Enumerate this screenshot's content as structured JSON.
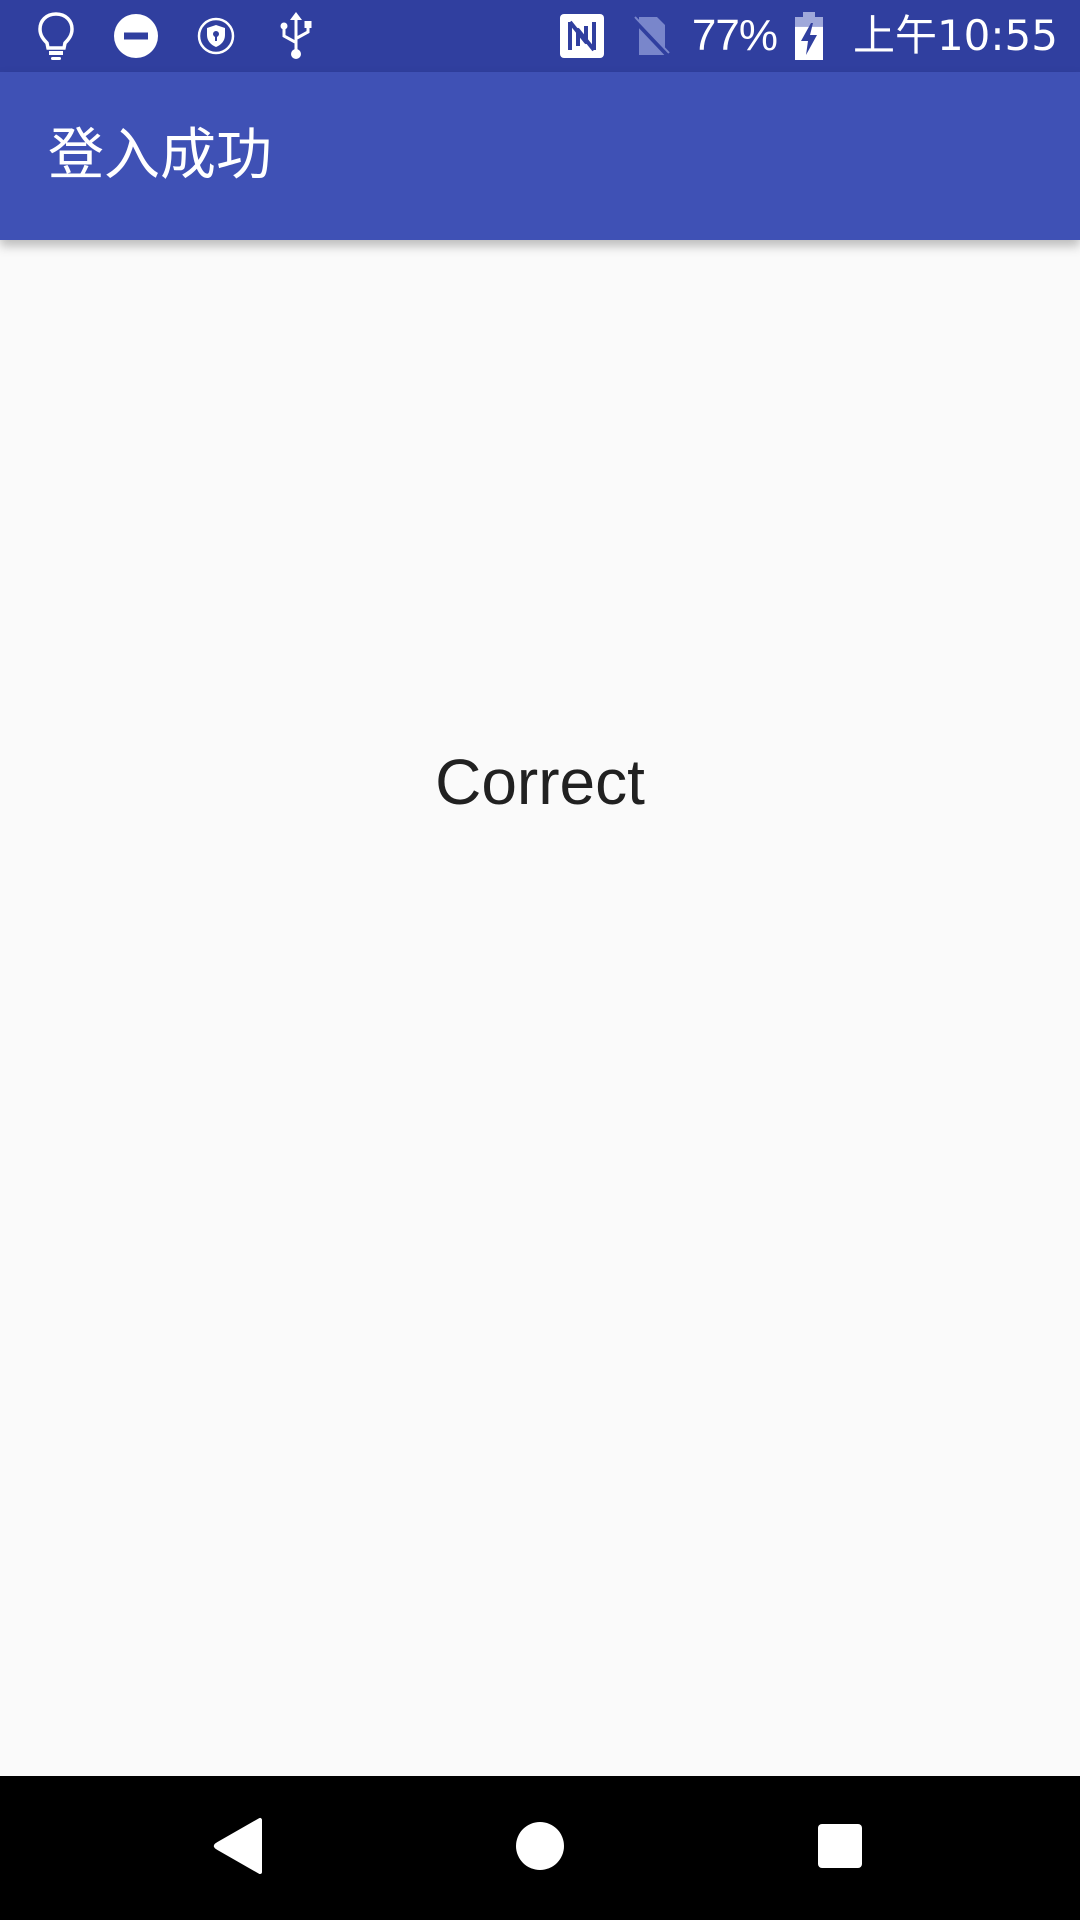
{
  "status_bar": {
    "left_icons": [
      "lightbulb-icon",
      "do-not-disturb-icon",
      "vpn-shield-icon",
      "usb-icon"
    ],
    "right_icons": [
      "nfc-icon",
      "no-sim-icon",
      "battery-charging-icon"
    ],
    "battery_percent": "77%",
    "battery_level": 0.77,
    "clock": "上午10:55",
    "background_color": "#303f9f"
  },
  "app_bar": {
    "title": "登入成功",
    "background_color": "#3f51b5"
  },
  "main": {
    "message": "Correct"
  },
  "nav_bar": {
    "buttons": [
      "back-icon",
      "home-icon",
      "recent-apps-icon"
    ]
  }
}
